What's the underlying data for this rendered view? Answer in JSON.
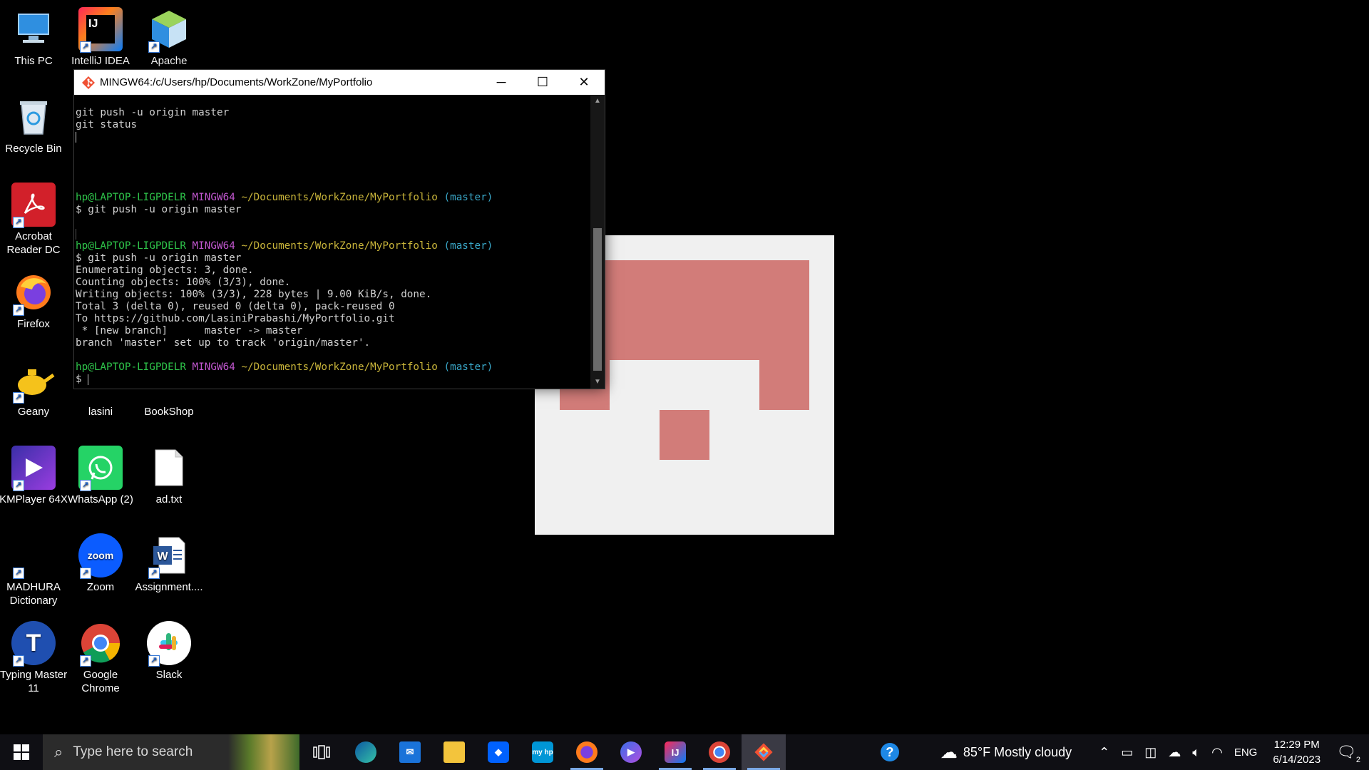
{
  "desktop": {
    "icons": [
      {
        "label": "This PC",
        "icon": "computer-icon"
      },
      {
        "label": "IntelliJ IDEA",
        "icon": "intellij-icon"
      },
      {
        "label": "Apache",
        "icon": "apache-netbeans-icon"
      },
      {
        "label": "Recycle Bin",
        "icon": "recycle-bin-icon"
      },
      {
        "label": "Acrobat Reader DC",
        "icon": "acrobat-icon"
      },
      {
        "label": "Firefox",
        "icon": "firefox-icon"
      },
      {
        "label": "Geany",
        "icon": "geany-icon"
      },
      {
        "label": "lasini",
        "icon": "folder-icon"
      },
      {
        "label": "BookShop",
        "icon": "folder-icon"
      },
      {
        "label": "KMPlayer 64X",
        "icon": "kmplayer-icon"
      },
      {
        "label": "WhatsApp (2)",
        "icon": "whatsapp-icon"
      },
      {
        "label": "ad.txt",
        "icon": "text-file-icon"
      },
      {
        "label": "MADHURA Dictionary",
        "icon": "dictionary-icon"
      },
      {
        "label": "Zoom",
        "icon": "zoom-icon"
      },
      {
        "label": "Assignment....",
        "icon": "word-doc-icon"
      },
      {
        "label": "Typing Master 11",
        "icon": "typing-master-icon"
      },
      {
        "label": "Google Chrome",
        "icon": "chrome-icon"
      },
      {
        "label": "Slack",
        "icon": "slack-icon"
      }
    ]
  },
  "terminal": {
    "title": "MINGW64:/c/Users/hp/Documents/WorkZone/MyPortfolio",
    "prompt": {
      "user": "hp@LAPTOP-LIGPDELR",
      "env": "MINGW64",
      "path": "~/Documents/WorkZone/MyPortfolio",
      "branch": "(master)"
    },
    "lines": {
      "l1": "git push -u origin master",
      "l2": "git status",
      "cmd1": "$ git push -u origin master",
      "cmd2": "$ git push -u origin master",
      "o1": "Enumerating objects: 3, done.",
      "o2": "Counting objects: 100% (3/3), done.",
      "o3": "Writing objects: 100% (3/3), 228 bytes | 9.00 KiB/s, done.",
      "o4": "Total 3 (delta 0), reused 0 (delta 0), pack-reused 0",
      "o5": "To https://github.com/LasiniPrabashi/MyPortfolio.git",
      "o6": " * [new branch]      master -> master",
      "o7": "branch 'master' set up to track 'origin/master'.",
      "last": "$ "
    },
    "controls": {
      "minimize": "─",
      "maximize": "☐",
      "close": "✕"
    }
  },
  "taskbar": {
    "search_placeholder": "Type here to search",
    "weather": "85°F  Mostly cloudy",
    "language": "ENG",
    "time": "12:29 PM",
    "date": "6/14/2023",
    "notifications": "2"
  }
}
